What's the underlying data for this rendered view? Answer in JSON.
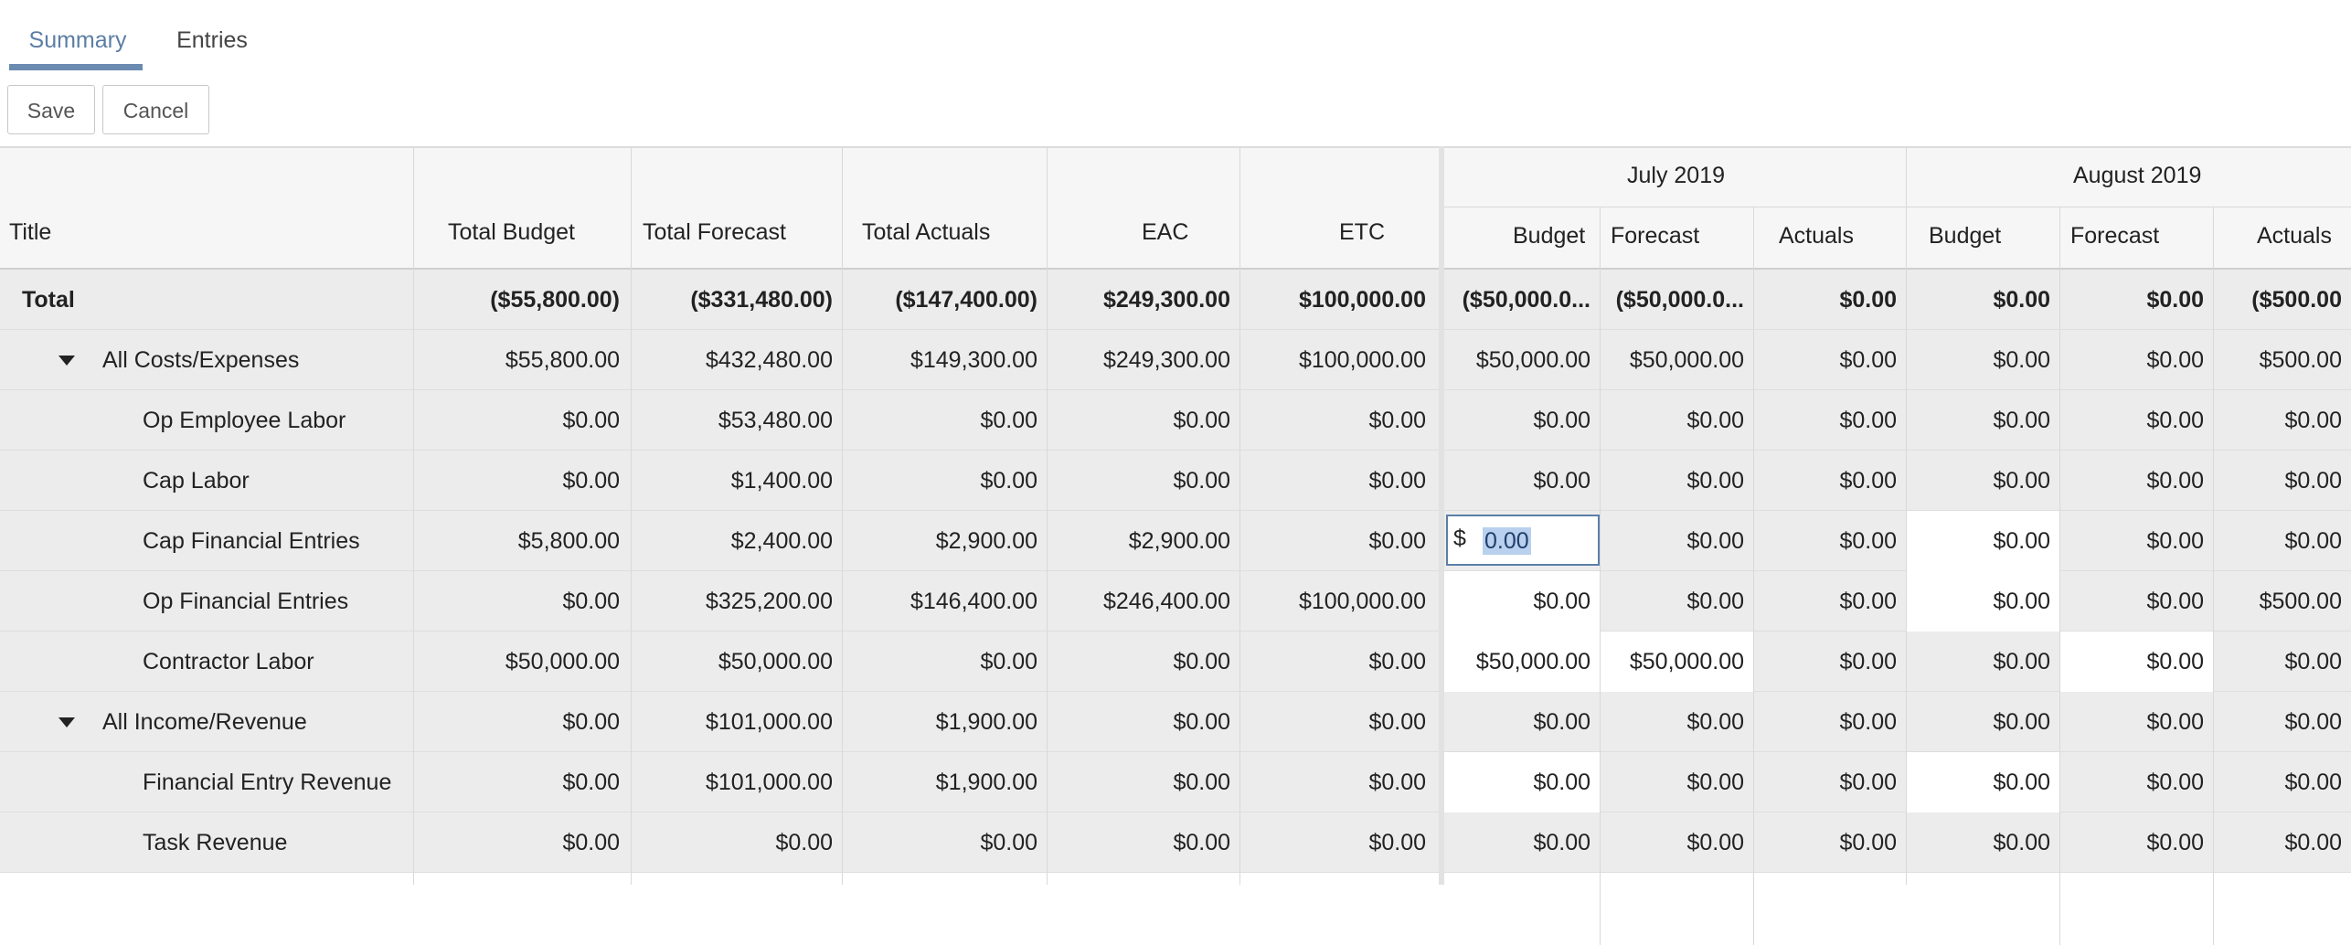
{
  "tabs": [
    {
      "label": "Summary",
      "active": true
    },
    {
      "label": "Entries",
      "active": false
    }
  ],
  "toolbar": {
    "save_label": "Save",
    "cancel_label": "Cancel"
  },
  "colors": {
    "accent": "#5c7ea5",
    "row_bg": "#ececec",
    "editable_bg": "#ffffff",
    "selection": "#b9d0ee"
  },
  "grid": {
    "headers": {
      "title": "Title",
      "total_budget": "Total Budget",
      "total_forecast": "Total Forecast",
      "total_actuals": "Total Actuals",
      "eac": "EAC",
      "etc": "ETC",
      "months": [
        {
          "label": "July 2019",
          "sub": [
            "Budget",
            "Forecast",
            "Actuals"
          ]
        },
        {
          "label": "August 2019",
          "sub": [
            "Budget",
            "Forecast",
            "Actuals"
          ]
        }
      ]
    },
    "rows": [
      {
        "title": "Total",
        "level": 0,
        "bold": true,
        "values": [
          "($55,800.00)",
          "($331,480.00)",
          "($147,400.00)",
          "$249,300.00",
          "$100,000.00"
        ],
        "months": [
          "($50,000.0...",
          "($50,000.0...",
          "$0.00",
          "$0.00",
          "$0.00",
          "($500.00"
        ]
      },
      {
        "title": "All Costs/Expenses",
        "level": 1,
        "expander": "caret-down-icon",
        "values": [
          "$55,800.00",
          "$432,480.00",
          "$149,300.00",
          "$249,300.00",
          "$100,000.00"
        ],
        "months": [
          "$50,000.00",
          "$50,000.00",
          "$0.00",
          "$0.00",
          "$0.00",
          "$500.00"
        ]
      },
      {
        "title": "Op Employee Labor",
        "level": 2,
        "values": [
          "$0.00",
          "$53,480.00",
          "$0.00",
          "$0.00",
          "$0.00"
        ],
        "months": [
          "$0.00",
          "$0.00",
          "$0.00",
          "$0.00",
          "$0.00",
          "$0.00"
        ]
      },
      {
        "title": "Cap Labor",
        "level": 2,
        "values": [
          "$0.00",
          "$1,400.00",
          "$0.00",
          "$0.00",
          "$0.00"
        ],
        "months": [
          "$0.00",
          "$0.00",
          "$0.00",
          "$0.00",
          "$0.00",
          "$0.00"
        ]
      },
      {
        "title": "Cap Financial Entries",
        "level": 2,
        "values": [
          "$5,800.00",
          "$2,400.00",
          "$2,900.00",
          "$2,900.00",
          "$0.00"
        ],
        "months": [
          "",
          "$0.00",
          "$0.00",
          "$0.00",
          "$0.00",
          "$0.00"
        ],
        "editing": {
          "currency": "$",
          "value": "0.00"
        }
      },
      {
        "title": "Op Financial Entries",
        "level": 2,
        "values": [
          "$0.00",
          "$325,200.00",
          "$146,400.00",
          "$246,400.00",
          "$100,000.00"
        ],
        "months": [
          "$0.00",
          "$0.00",
          "$0.00",
          "$0.00",
          "$0.00",
          "$500.00"
        ]
      },
      {
        "title": "Contractor Labor",
        "level": 2,
        "values": [
          "$50,000.00",
          "$50,000.00",
          "$0.00",
          "$0.00",
          "$0.00"
        ],
        "months": [
          "$50,000.00",
          "$50,000.00",
          "$0.00",
          "$0.00",
          "$0.00",
          "$0.00"
        ]
      },
      {
        "title": "All Income/Revenue",
        "level": 1,
        "expander": "caret-down-icon",
        "values": [
          "$0.00",
          "$101,000.00",
          "$1,900.00",
          "$0.00",
          "$0.00"
        ],
        "months": [
          "$0.00",
          "$0.00",
          "$0.00",
          "$0.00",
          "$0.00",
          "$0.00"
        ]
      },
      {
        "title": "Financial Entry Revenue",
        "level": 2,
        "values": [
          "$0.00",
          "$101,000.00",
          "$1,900.00",
          "$0.00",
          "$0.00"
        ],
        "months": [
          "$0.00",
          "$0.00",
          "$0.00",
          "$0.00",
          "$0.00",
          "$0.00"
        ]
      },
      {
        "title": "Task Revenue",
        "level": 2,
        "values": [
          "$0.00",
          "$0.00",
          "$0.00",
          "$0.00",
          "$0.00"
        ],
        "months": [
          "$0.00",
          "$0.00",
          "$0.00",
          "$0.00",
          "$0.00",
          "$0.00"
        ]
      }
    ]
  }
}
